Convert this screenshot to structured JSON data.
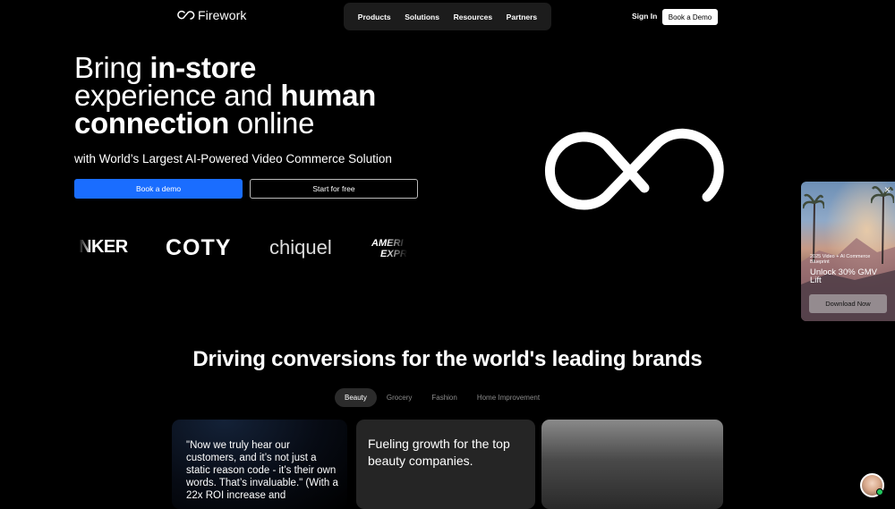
{
  "header": {
    "logo_text": "Firework",
    "nav": [
      "Products",
      "Solutions",
      "Resources",
      "Partners"
    ],
    "sign_in": "Sign In",
    "book_demo": "Book a Demo"
  },
  "hero": {
    "title_line1_a": "Bring ",
    "title_line1_b": "in-store",
    "title_line2_a": "experience and ",
    "title_line2_b": "human",
    "title_line3_a": "connection",
    "title_line3_b": " online",
    "subtitle": "with World’s Largest AI-Powered Video Commerce Solution",
    "primary_cta": "Book a demo",
    "secondary_cta": "Start for free"
  },
  "brands": {
    "anker": "NKER",
    "coty": "COTY",
    "chiquel": "chiquel",
    "amex_line1": "AMERI",
    "amex_line2": "EXPR"
  },
  "promo": {
    "small_text": "2025 Video + AI Commerce Blueprint",
    "headline": "Unlock 30% GMV Lift",
    "button": "Download Now",
    "close": "×"
  },
  "section": {
    "title": "Driving conversions for the world's leading brands",
    "tabs": [
      "Beauty",
      "Grocery",
      "Fashion",
      "Home Improvement"
    ],
    "active_tab": "Beauty",
    "quote": "\"Now we truly hear our customers, and it’s not just a static reason code - it’s their own words. That’s invaluable.\" (With a 22x ROI increase and",
    "growth_text": "Fueling growth for the top beauty companies."
  },
  "colors": {
    "background": "#000000",
    "primary": "#1a6dff",
    "nav_bg": "#1c1c1c",
    "card_bg": "#252525",
    "status_online": "#22c55e"
  },
  "icons": {
    "logo": "infinity-logo-icon",
    "hero_mark": "infinity-mark-icon",
    "close": "close-icon",
    "chat": "chat-avatar"
  }
}
